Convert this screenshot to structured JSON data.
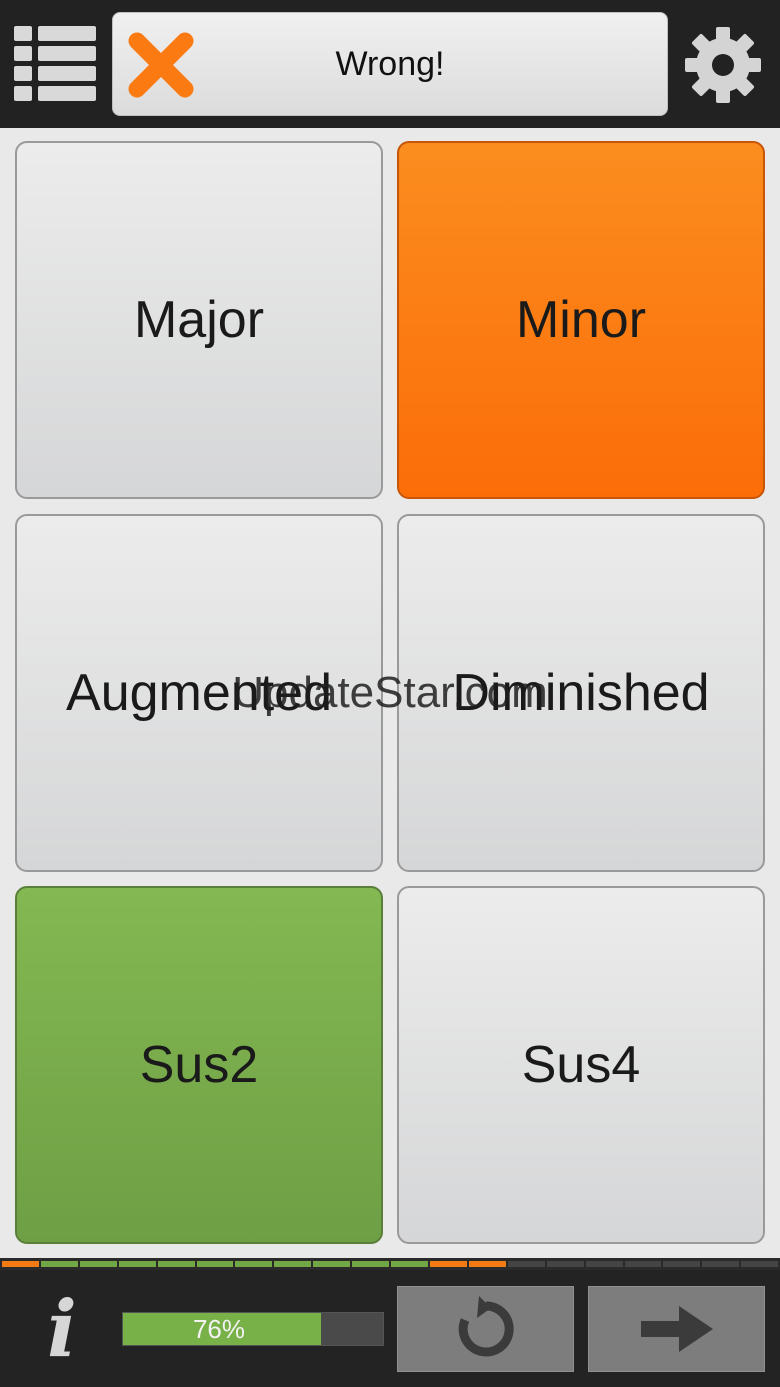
{
  "header": {
    "status_text": "Wrong!",
    "icons": {
      "menu": "list-icon",
      "status": "x-mark-icon",
      "settings": "gear-icon"
    }
  },
  "answers": [
    {
      "label": "Major",
      "state": "default"
    },
    {
      "label": "Minor",
      "state": "selected-wrong"
    },
    {
      "label": "Augmented",
      "state": "default"
    },
    {
      "label": "Diminished",
      "state": "default"
    },
    {
      "label": "Sus2",
      "state": "correct"
    },
    {
      "label": "Sus4",
      "state": "default"
    }
  ],
  "watermark": "UpdateStar.com",
  "history": [
    "wrong",
    "correct",
    "correct",
    "correct",
    "correct",
    "correct",
    "correct",
    "correct",
    "correct",
    "correct",
    "correct",
    "wrong",
    "wrong",
    "empty",
    "empty",
    "empty",
    "empty",
    "empty",
    "empty",
    "empty"
  ],
  "footer": {
    "score_percent": 76,
    "score_label": "76%",
    "icons": {
      "info": "info-icon",
      "replay": "replay-icon",
      "next": "arrow-right-icon"
    }
  },
  "colors": {
    "wrong": "#fb7a12",
    "correct": "#77b147",
    "bar_dark": "#222222"
  }
}
